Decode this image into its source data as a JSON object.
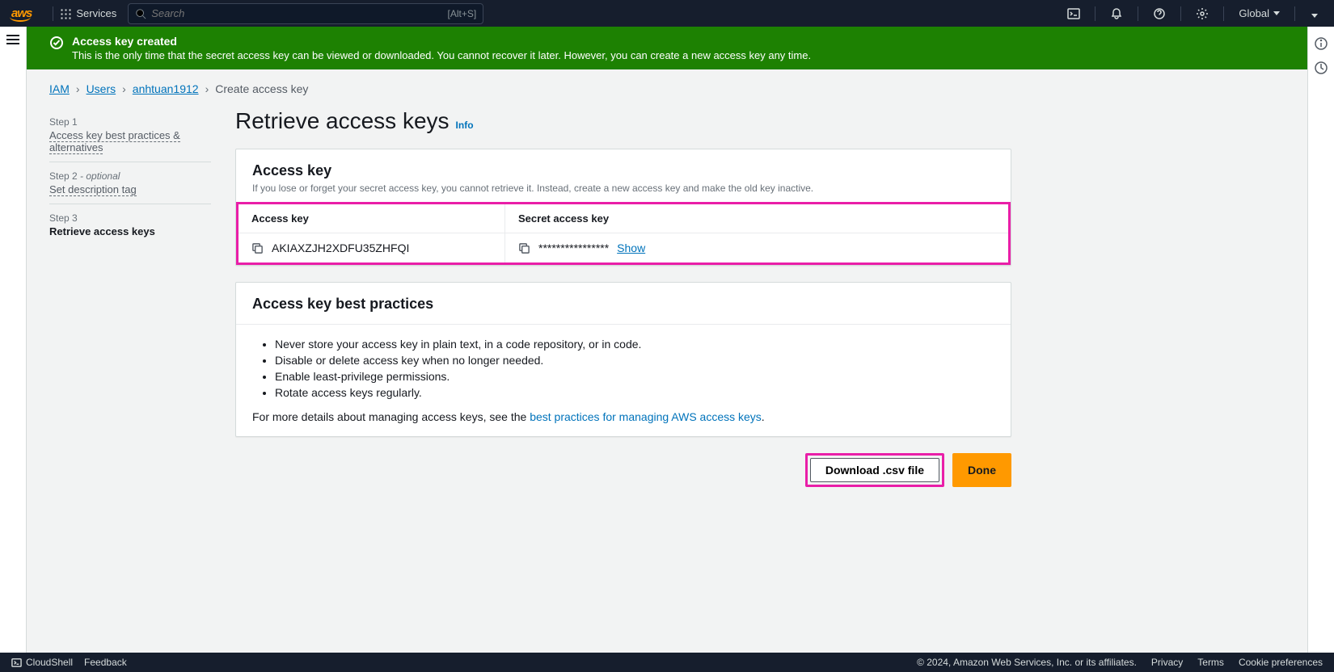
{
  "nav": {
    "services": "Services",
    "search_placeholder": "Search",
    "search_shortcut": "[Alt+S]",
    "region": "Global"
  },
  "flash": {
    "title": "Access key created",
    "body": "This is the only time that the secret access key can be viewed or downloaded. You cannot recover it later. However, you can create a new access key any time."
  },
  "breadcrumb": {
    "iam": "IAM",
    "users": "Users",
    "user": "anhtuan1912",
    "current": "Create access key"
  },
  "steps": {
    "s1label": "Step 1",
    "s1name": "Access key best practices & alternatives",
    "s2label": "Step 2",
    "s2optional": "- optional",
    "s2name": "Set description tag",
    "s3label": "Step 3",
    "s3name": "Retrieve access keys"
  },
  "page": {
    "title": "Retrieve access keys",
    "info": "Info"
  },
  "key_panel": {
    "heading": "Access key",
    "desc": "If you lose or forget your secret access key, you cannot retrieve it. Instead, create a new access key and make the old key inactive.",
    "col_access": "Access key",
    "col_secret": "Secret access key",
    "access_key": "AKIAXZJH2XDFU35ZHFQI",
    "secret_masked": "****************",
    "show": "Show"
  },
  "bp_panel": {
    "heading": "Access key best practices",
    "items": [
      "Never store your access key in plain text, in a code repository, or in code.",
      "Disable or delete access key when no longer needed.",
      "Enable least-privilege permissions.",
      "Rotate access keys regularly."
    ],
    "more_pre": "For more details about managing access keys, see the ",
    "more_link": "best practices for managing AWS access keys"
  },
  "actions": {
    "download": "Download .csv file",
    "done": "Done"
  },
  "footer": {
    "cloudshell": "CloudShell",
    "feedback": "Feedback",
    "copyright": "© 2024, Amazon Web Services, Inc. or its affiliates.",
    "privacy": "Privacy",
    "terms": "Terms",
    "cookies": "Cookie preferences"
  }
}
